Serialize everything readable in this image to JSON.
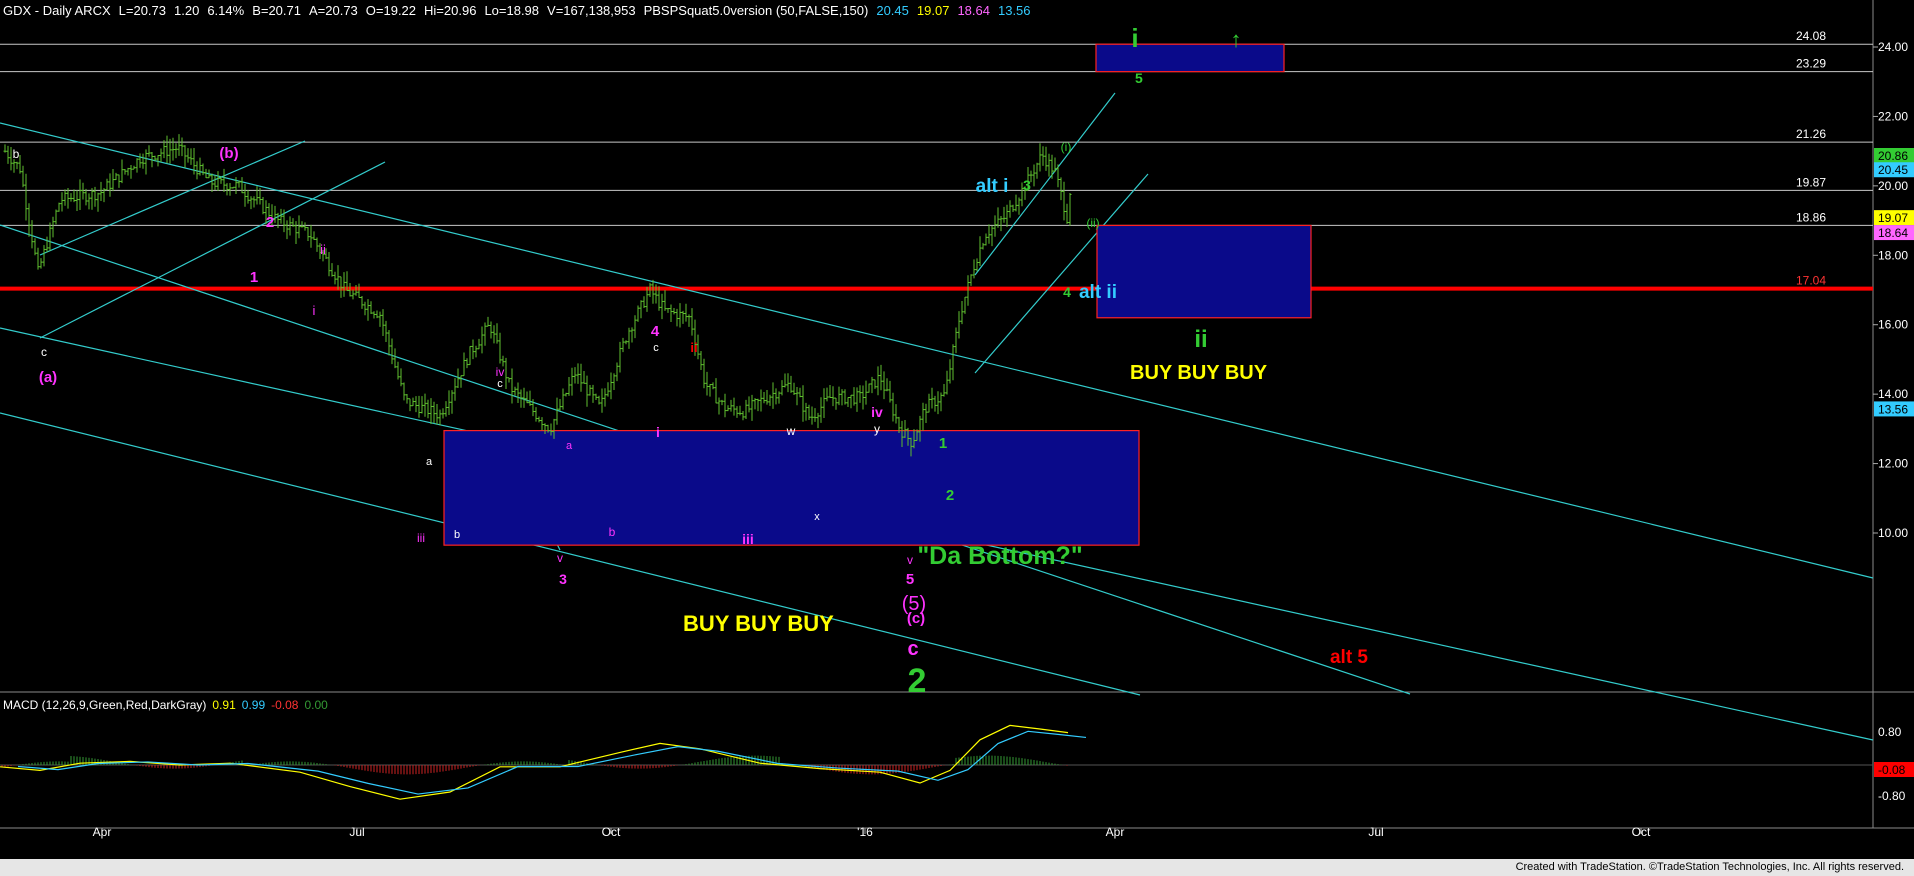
{
  "header": {
    "symbol": "GDX - Daily  ARCX",
    "last": "L=20.73",
    "change": "1.20",
    "change_pct": "6.14%",
    "bid": "B=20.71",
    "ask": "A=20.73",
    "open": "O=19.22",
    "high": "Hi=20.96",
    "low": "Lo=18.98",
    "volume": "V=167,138,953",
    "indicator": "PBSPSquat5.0version (50,FALSE,150)",
    "ind_values": [
      "20.45",
      "19.07",
      "18.64",
      "13.56"
    ],
    "ind_colors": [
      "#33ccff",
      "#ffff00",
      "#ff66ff",
      "#33ccff"
    ]
  },
  "macd_header": {
    "label": "MACD (12,26,9,Green,Red,DarkGray)",
    "values": [
      "0.91",
      "0.99",
      "-0.08",
      "0.00"
    ],
    "colors": [
      "#ffff00",
      "#33ccff",
      "#ff3333",
      "#339933"
    ]
  },
  "footer": "Created with TradeStation. ©TradeStation Technologies, Inc. All rights reserved.",
  "chart_data": {
    "type": "candlestick",
    "price_axis": {
      "ticks": [
        "24.00",
        "22.00",
        "20.00",
        "18.00",
        "16.00",
        "14.00",
        "12.00",
        "10.00"
      ],
      "ylim": [
        8.5,
        25.2
      ]
    },
    "macd_axis": {
      "ticks": [
        "0.80",
        "-0.80"
      ]
    },
    "x_axis": {
      "ticks": [
        "Apr",
        "Jul",
        "Oct",
        "'16",
        "Apr",
        "Jul",
        "Oct"
      ]
    },
    "horizontal_levels": [
      {
        "value": 24.08,
        "label": "24.08",
        "color": "#ffffff"
      },
      {
        "value": 23.29,
        "label": "23.29",
        "color": "#ffffff"
      },
      {
        "value": 21.26,
        "label": "21.26",
        "color": "#ffffff"
      },
      {
        "value": 19.87,
        "label": "19.87",
        "color": "#ffffff"
      },
      {
        "value": 18.86,
        "label": "18.86",
        "color": "#ffffff"
      },
      {
        "value": 17.04,
        "label": "17.04",
        "color": "#ff0000"
      }
    ],
    "axis_markers": [
      {
        "value": 20.86,
        "label": "20.86",
        "bg": "#33cc33",
        "fg": "#000000"
      },
      {
        "value": 20.45,
        "label": "20.45",
        "bg": "#33ccff",
        "fg": "#000000"
      },
      {
        "value": 19.07,
        "label": "19.07",
        "bg": "#ffff00",
        "fg": "#000000"
      },
      {
        "value": 18.64,
        "label": "18.64",
        "bg": "#ff66ff",
        "fg": "#000000"
      },
      {
        "value": 13.56,
        "label": "13.56",
        "bg": "#33ccff",
        "fg": "#000000"
      }
    ],
    "macd_markers": [
      {
        "label": "-0.08",
        "bg": "#ff0000",
        "fg": "#000000"
      }
    ],
    "boxes": [
      {
        "name": "target-box",
        "label": "5",
        "label_color": "#33cc33",
        "price_top": 24.08,
        "price_bottom": 23.29
      },
      {
        "name": "buy-zone-upper",
        "label": "BUY  BUY   BUY",
        "label_color": "#ffff00",
        "price_top": 18.86,
        "price_bottom": 16.2
      },
      {
        "name": "buy-zone-lower",
        "label": "BUY BUY BUY",
        "label_color": "#ffff00",
        "price_top": 12.95,
        "price_bottom": 9.65
      }
    ],
    "wave_labels": [
      {
        "text": "i",
        "color": "#33cc33"
      },
      {
        "text": "↑",
        "color": "#33cc33"
      },
      {
        "text": "b",
        "color": "#ffffff"
      },
      {
        "text": "(b)",
        "color": "#ff33ff"
      },
      {
        "text": "2",
        "color": "#ff33ff"
      },
      {
        "text": "1",
        "color": "#ff33ff"
      },
      {
        "text": "ii",
        "color": "#ff33ff"
      },
      {
        "text": "i",
        "color": "#ff33ff"
      },
      {
        "text": "c",
        "color": "#ffffff"
      },
      {
        "text": "(a)",
        "color": "#ff33ff"
      },
      {
        "text": "a",
        "color": "#ffffff"
      },
      {
        "text": "iii",
        "color": "#ff33ff"
      },
      {
        "text": "b",
        "color": "#ffffff"
      },
      {
        "text": "iv",
        "color": "#ff33ff"
      },
      {
        "text": "c",
        "color": "#ffffff"
      },
      {
        "text": "v",
        "color": "#ff33ff"
      },
      {
        "text": "3",
        "color": "#ff33ff"
      },
      {
        "text": "a",
        "color": "#ff33ff"
      },
      {
        "text": "b",
        "color": "#ff33ff"
      },
      {
        "text": "4",
        "color": "#ff33ff"
      },
      {
        "text": "c",
        "color": "#ffffff"
      },
      {
        "text": "ii",
        "color": "#ff0000"
      },
      {
        "text": "i",
        "color": "#ff33ff"
      },
      {
        "text": "iii",
        "color": "#ff33ff"
      },
      {
        "text": "w",
        "color": "#ffffff"
      },
      {
        "text": "x",
        "color": "#ffffff"
      },
      {
        "text": "y",
        "color": "#ffffff"
      },
      {
        "text": "iv",
        "color": "#ff33ff"
      },
      {
        "text": "v",
        "color": "#ff33ff"
      },
      {
        "text": "5",
        "color": "#ff33ff"
      },
      {
        "text": "(5)",
        "color": "#ff33ff"
      },
      {
        "text": "(c)",
        "color": "#ff33ff"
      },
      {
        "text": "c",
        "color": "#ff33ff"
      },
      {
        "text": "2",
        "color": "#33cc33"
      },
      {
        "text": "\"Da Bottom?\"",
        "color": "#33cc33"
      },
      {
        "text": "1",
        "color": "#33cc33"
      },
      {
        "text": "2",
        "color": "#33cc33"
      },
      {
        "text": "alt i",
        "color": "#33ccff"
      },
      {
        "text": "3",
        "color": "#33cc33"
      },
      {
        "text": "(i)",
        "color": "#33cc33"
      },
      {
        "text": "(ii)",
        "color": "#33cc33"
      },
      {
        "text": "4",
        "color": "#33cc33"
      },
      {
        "text": "alt ii",
        "color": "#33ccff"
      },
      {
        "text": "ii",
        "color": "#33cc33"
      },
      {
        "text": "alt 5",
        "color": "#ff0000"
      }
    ]
  }
}
